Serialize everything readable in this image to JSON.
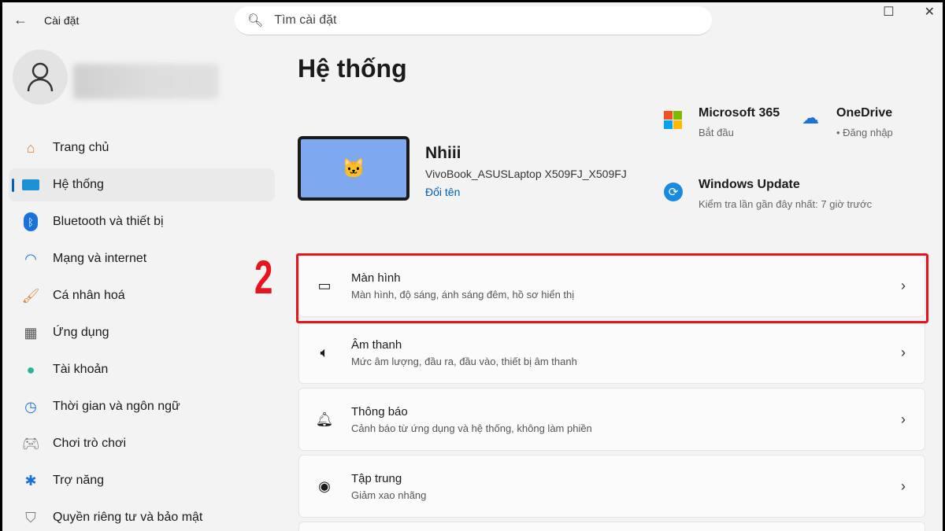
{
  "app": {
    "title": "Cài đặt",
    "search_placeholder": "Tìm cài đặt"
  },
  "sidebar": {
    "items": [
      {
        "label": "Trang chủ",
        "icon": "home-icon"
      },
      {
        "label": "Hệ thống",
        "icon": "system-icon",
        "active": true
      },
      {
        "label": "Bluetooth và thiết bị",
        "icon": "bluetooth-icon"
      },
      {
        "label": "Mạng và internet",
        "icon": "wifi-icon"
      },
      {
        "label": "Cá nhân hoá",
        "icon": "brush-icon"
      },
      {
        "label": "Ứng dụng",
        "icon": "apps-icon"
      },
      {
        "label": "Tài khoản",
        "icon": "account-icon"
      },
      {
        "label": "Thời gian và ngôn ngữ",
        "icon": "clock-icon"
      },
      {
        "label": "Chơi trò chơi",
        "icon": "gamepad-icon"
      },
      {
        "label": "Trợ năng",
        "icon": "accessibility-icon"
      },
      {
        "label": "Quyền riêng tư và bảo mật",
        "icon": "shield-icon"
      }
    ]
  },
  "main": {
    "title": "Hệ thống",
    "device": {
      "name": "Nhiii",
      "model": "VivoBook_ASUSLaptop X509FJ_X509FJ",
      "rename": "Đổi tên"
    },
    "tiles": [
      {
        "title": "Microsoft 365",
        "sub": "Bắt đầu"
      },
      {
        "title": "OneDrive",
        "sub": "• Đăng nhập"
      },
      {
        "title": "Windows Update",
        "sub": "Kiểm tra lần gần đây nhất: 7 giờ trước"
      }
    ],
    "cards": [
      {
        "title": "Màn hình",
        "sub": "Màn hình, độ sáng, ánh sáng đêm, hồ sơ hiển thị",
        "icon": "laptop-icon"
      },
      {
        "title": "Âm thanh",
        "sub": "Mức âm lượng, đầu ra, đầu vào, thiết bị âm thanh",
        "icon": "speaker-icon"
      },
      {
        "title": "Thông báo",
        "sub": "Cảnh báo từ ứng dụng và hệ thống, không làm phiền",
        "icon": "bell-icon"
      },
      {
        "title": "Tập trung",
        "sub": "Giảm xao nhãng",
        "icon": "focus-icon"
      }
    ],
    "step_number": "2"
  },
  "colors": {
    "accent": "#005fb8",
    "highlight": "#e8141c"
  }
}
